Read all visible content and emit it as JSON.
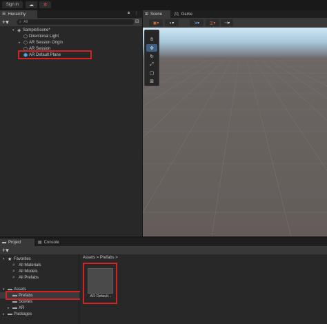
{
  "toolbar": {
    "signin_label": "Sign in",
    "cloud_icon": "cloud-icon",
    "collab_icon": "collab-icon"
  },
  "hierarchy": {
    "tab_label": "Hierarchy",
    "add_label": "+▾",
    "search_placeholder": "All",
    "items": [
      {
        "label": "SampleScene*",
        "icon": "unity-scene-icon",
        "expanded": true
      },
      {
        "label": "Directional Light",
        "icon": "gameobject-icon"
      },
      {
        "label": "AR Session Origin",
        "icon": "gameobject-icon",
        "collapsed": true
      },
      {
        "label": "AR Session",
        "icon": "gameobject-icon"
      },
      {
        "label": "AR Default Plane",
        "icon": "prefab-icon"
      }
    ]
  },
  "scene": {
    "tab_scene": "Scene",
    "tab_game": "Game",
    "tools": [
      {
        "name": "hand-tool",
        "glyph": "✋"
      },
      {
        "name": "move-tool",
        "glyph": "✥"
      },
      {
        "name": "rotate-tool",
        "glyph": "↻"
      },
      {
        "name": "scale-tool",
        "glyph": "⤢"
      },
      {
        "name": "rect-tool",
        "glyph": "▢"
      },
      {
        "name": "transform-tool",
        "glyph": "⊞"
      }
    ]
  },
  "project": {
    "tab_project": "Project",
    "tab_console": "Console",
    "add_label": "+▾",
    "favorites_label": "Favorites",
    "favorites": [
      "All Materials",
      "All Models",
      "All Prefabs"
    ],
    "assets_label": "Assets",
    "assets_children": [
      "Prefabs",
      "Scenes",
      "XR"
    ],
    "packages_label": "Packages",
    "breadcrumb": "Assets > Prefabs >",
    "asset_item_label": "AR Default..."
  },
  "colors": {
    "highlight": "#d32424",
    "prefab_blue": "#4aa5e8",
    "active_tool": "#3d5f84"
  }
}
